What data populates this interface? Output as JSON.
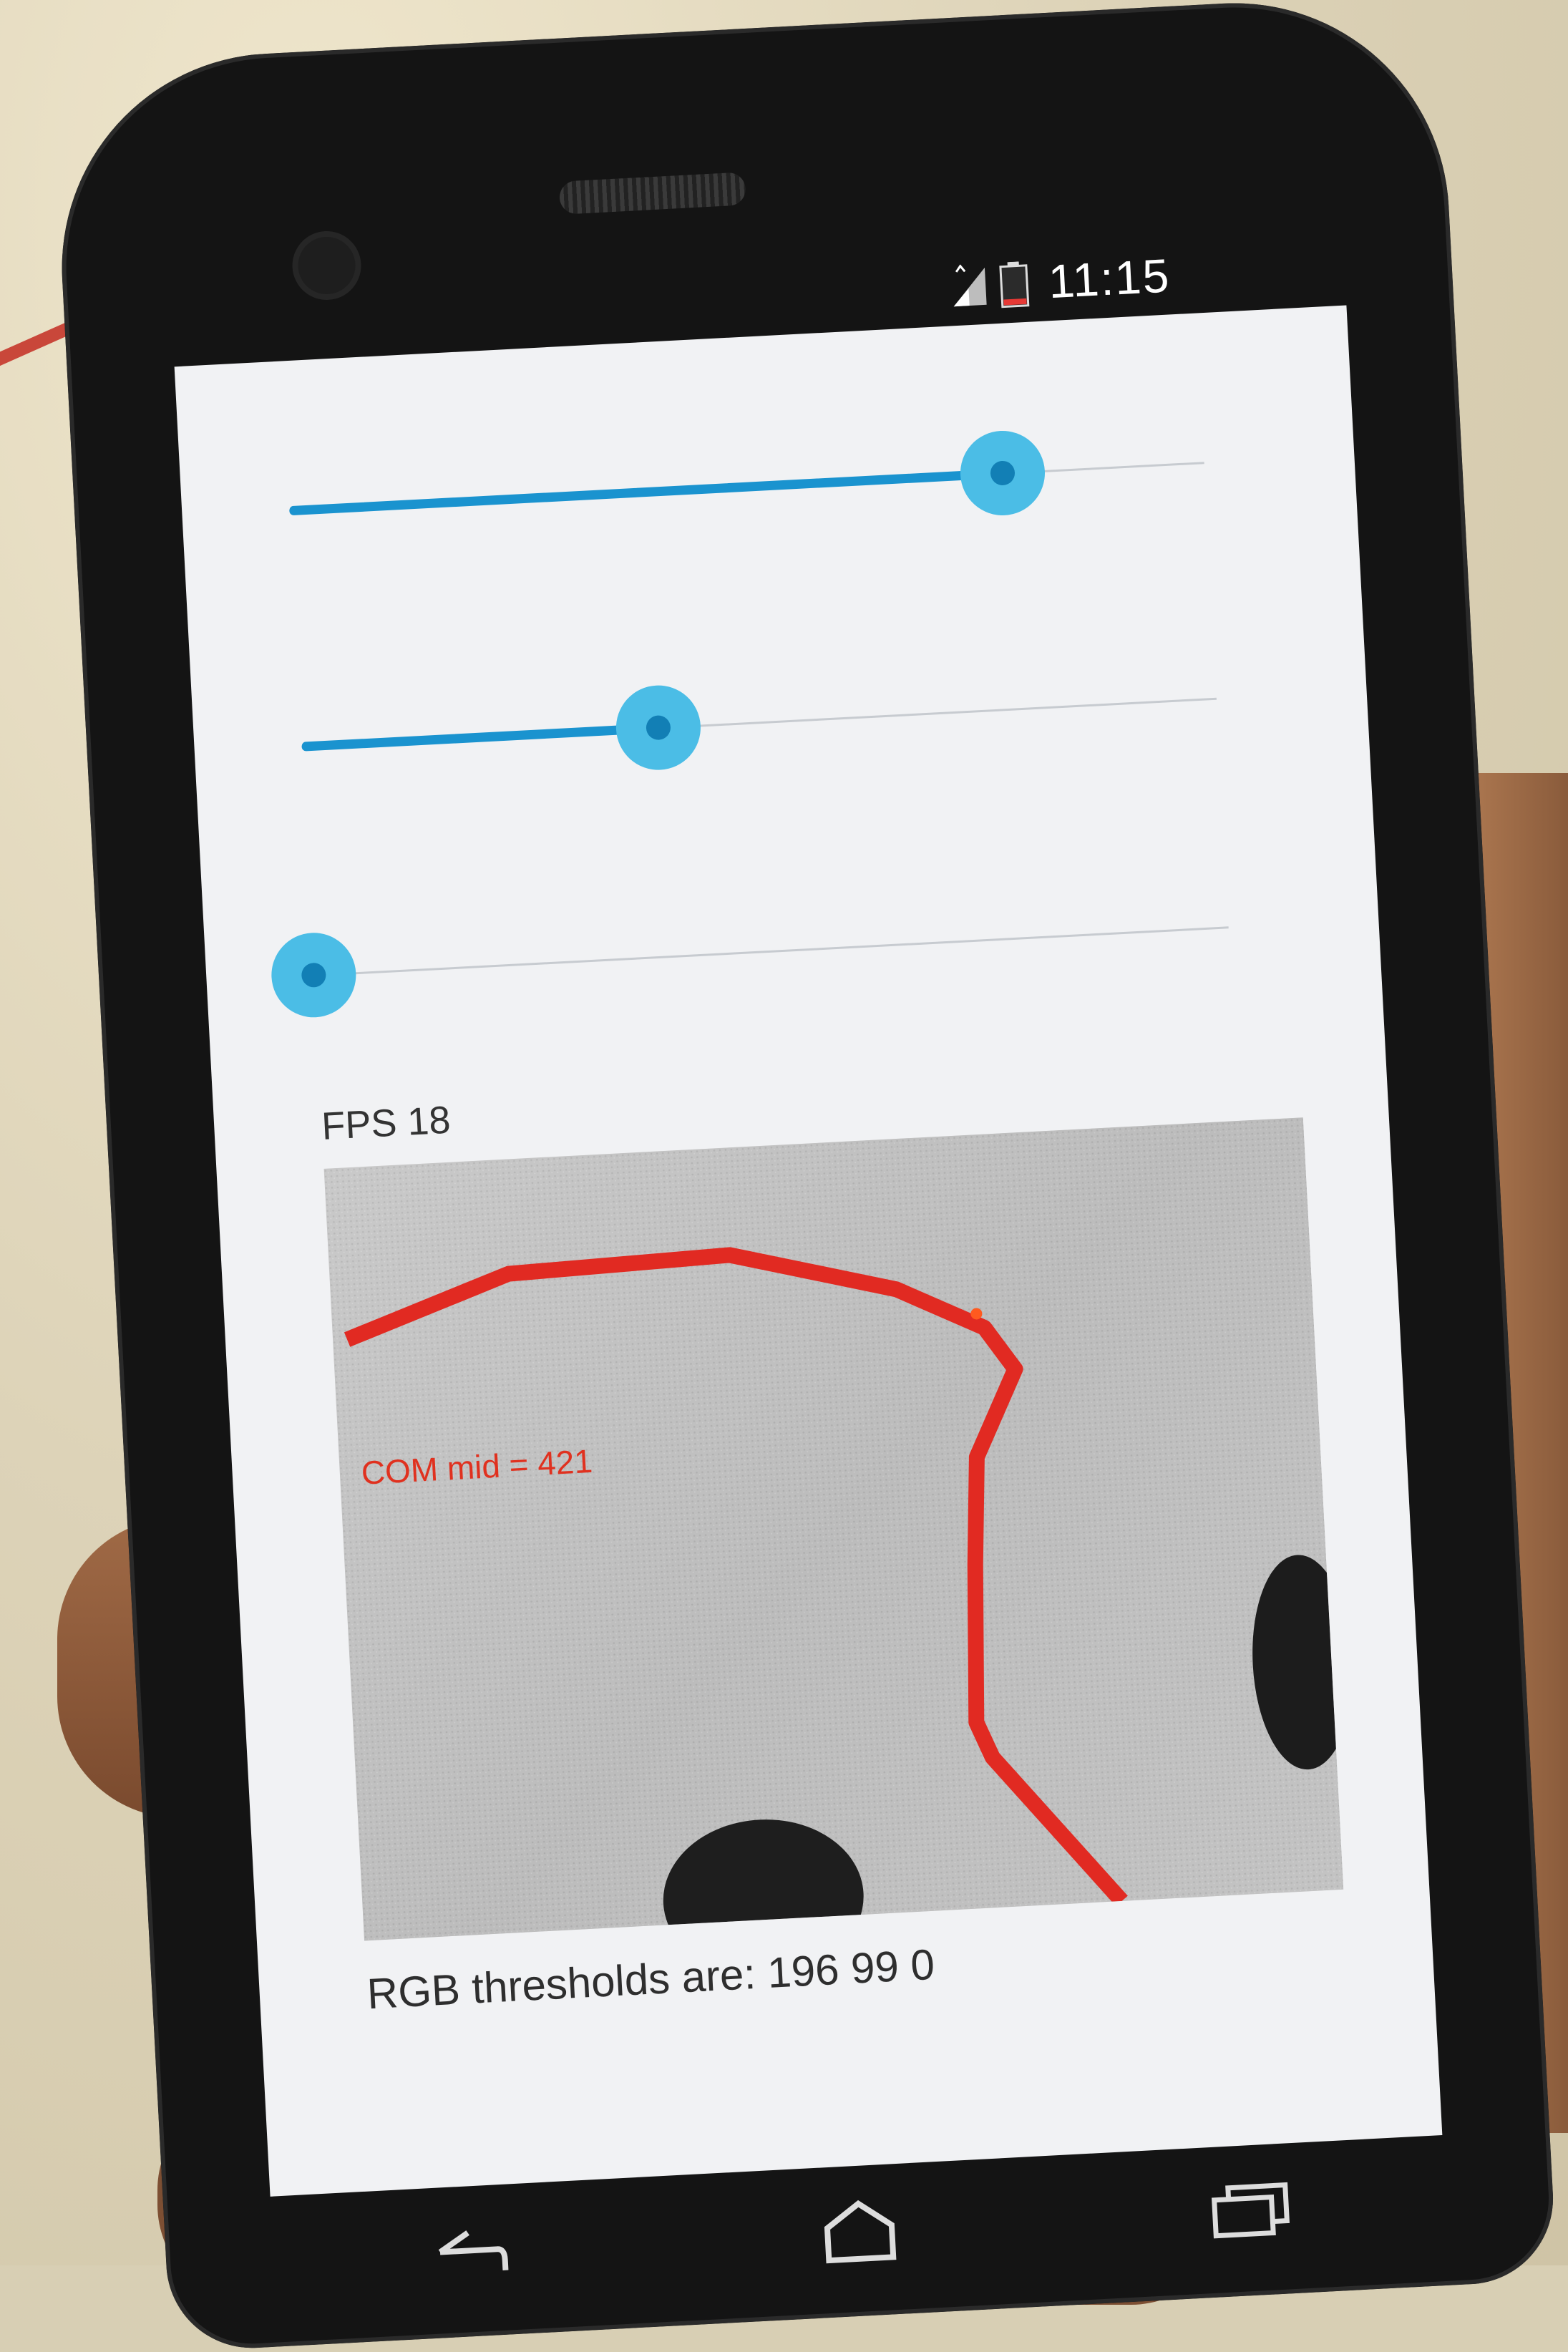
{
  "status_bar": {
    "time": "11:15",
    "icons": [
      "signal-icon",
      "battery-icon"
    ]
  },
  "sliders": [
    {
      "name": "red-threshold-slider",
      "value_fraction": 0.78
    },
    {
      "name": "green-threshold-slider",
      "value_fraction": 0.39
    },
    {
      "name": "blue-threshold-slider",
      "value_fraction": 0.0
    }
  ],
  "fps_label": "FPS 18",
  "camera": {
    "overlay_text": "COM mid = 421"
  },
  "rgb_label": "RGB thresholds are: 196 99 0",
  "nav": {
    "buttons": [
      "back-icon",
      "home-icon",
      "recent-apps-icon"
    ]
  },
  "colors": {
    "accent": "#1a93cf",
    "thumb": "#4bbde6",
    "overlay_text": "#e0311f",
    "tape_line": "#e12a22"
  }
}
